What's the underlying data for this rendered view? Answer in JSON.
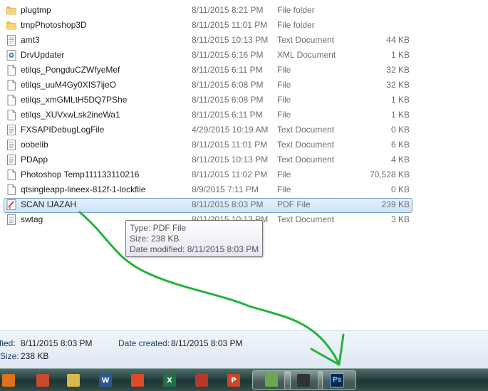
{
  "files": [
    {
      "name": "plugtmp",
      "date": "8/11/2015 8:21 PM",
      "type": "File folder",
      "size": "",
      "icon": "folder-icon",
      "selected": false
    },
    {
      "name": "tmpPhotoshop3D",
      "date": "8/11/2015 11:01 PM",
      "type": "File folder",
      "size": "",
      "icon": "folder-icon",
      "selected": false
    },
    {
      "name": "amt3",
      "date": "8/11/2015 10:13 PM",
      "type": "Text Document",
      "size": "44 KB",
      "icon": "text-document-icon",
      "selected": false
    },
    {
      "name": "DrvUpdater",
      "date": "8/11/2015 6:16 PM",
      "type": "XML Document",
      "size": "1 KB",
      "icon": "xml-document-icon",
      "selected": false
    },
    {
      "name": "etilqs_PongduCZWfyeMef",
      "date": "8/11/2015 6:11 PM",
      "type": "File",
      "size": "32 KB",
      "icon": "file-icon",
      "selected": false
    },
    {
      "name": "etilqs_uuM4Gy0XIS7ijeO",
      "date": "8/11/2015 6:08 PM",
      "type": "File",
      "size": "32 KB",
      "icon": "file-icon",
      "selected": false
    },
    {
      "name": "etilqs_xmGMLtH5DQ7PShe",
      "date": "8/11/2015 6:08 PM",
      "type": "File",
      "size": "1 KB",
      "icon": "file-icon",
      "selected": false
    },
    {
      "name": "etilqs_XUVxwLsk2ineWa1",
      "date": "8/11/2015 6:11 PM",
      "type": "File",
      "size": "1 KB",
      "icon": "file-icon",
      "selected": false
    },
    {
      "name": "FXSAPIDebugLogFile",
      "date": "4/29/2015 10:19 AM",
      "type": "Text Document",
      "size": "0 KB",
      "icon": "text-document-icon",
      "selected": false
    },
    {
      "name": "oobelib",
      "date": "8/11/2015 11:01 PM",
      "type": "Text Document",
      "size": "6 KB",
      "icon": "text-document-icon",
      "selected": false
    },
    {
      "name": "PDApp",
      "date": "8/11/2015 10:13 PM",
      "type": "Text Document",
      "size": "4 KB",
      "icon": "text-document-icon",
      "selected": false
    },
    {
      "name": "Photoshop Temp111133110216",
      "date": "8/11/2015 11:02 PM",
      "type": "File",
      "size": "70,528 KB",
      "icon": "file-icon",
      "selected": false
    },
    {
      "name": "qtsingleapp-lineex-812f-1-lockfile",
      "date": "8/9/2015 7:11 PM",
      "type": "File",
      "size": "0 KB",
      "icon": "file-icon",
      "selected": false
    },
    {
      "name": "SCAN IJAZAH",
      "date": "8/11/2015 8:03 PM",
      "type": "PDF File",
      "size": "239 KB",
      "icon": "pdf-icon",
      "selected": true
    },
    {
      "name": "swtag",
      "date": "8/11/2015 10:13 PM",
      "type": "Text Document",
      "size": "3 KB",
      "icon": "text-document-icon",
      "selected": false
    }
  ],
  "tooltip": {
    "type_line": "Type: PDF File",
    "size_line": "Size: 238 KB",
    "date_line": "Date modified: 8/11/2015 8:03 PM"
  },
  "details": {
    "modified_label": "fied:",
    "modified_value": "8/11/2015 8:03 PM",
    "created_label": "Date created:",
    "created_value": "8/11/2015 8:03 PM",
    "size_label": "Size:",
    "size_value": "238 KB"
  },
  "taskbar": {
    "items": [
      {
        "name": "firefox",
        "icon": "firefox-icon",
        "label": "",
        "color": "#e0701a"
      },
      {
        "name": "chrome-app",
        "icon": "app-icon",
        "label": "",
        "color": "#c94a2c"
      },
      {
        "name": "tools",
        "icon": "tools-icon",
        "label": "",
        "color": "#d9b94a"
      },
      {
        "name": "word",
        "icon": "word-icon",
        "label": "W",
        "color": "#2b5797"
      },
      {
        "name": "browser",
        "icon": "globe-icon",
        "label": "",
        "color": "#d94b2b"
      },
      {
        "name": "excel",
        "icon": "excel-icon",
        "label": "X",
        "color": "#1e7145"
      },
      {
        "name": "books",
        "icon": "books-icon",
        "label": "",
        "color": "#b33a2a"
      },
      {
        "name": "powerpoint",
        "icon": "powerpoint-icon",
        "label": "P",
        "color": "#c9462a"
      },
      {
        "name": "messenger",
        "icon": "messenger-icon",
        "label": "",
        "color": "#6aa84f"
      },
      {
        "name": "media",
        "icon": "media-icon",
        "label": "",
        "color": "#333333"
      },
      {
        "name": "photoshop",
        "icon": "photoshop-icon",
        "label": "Ps",
        "color": "#0b2a4a"
      }
    ]
  }
}
